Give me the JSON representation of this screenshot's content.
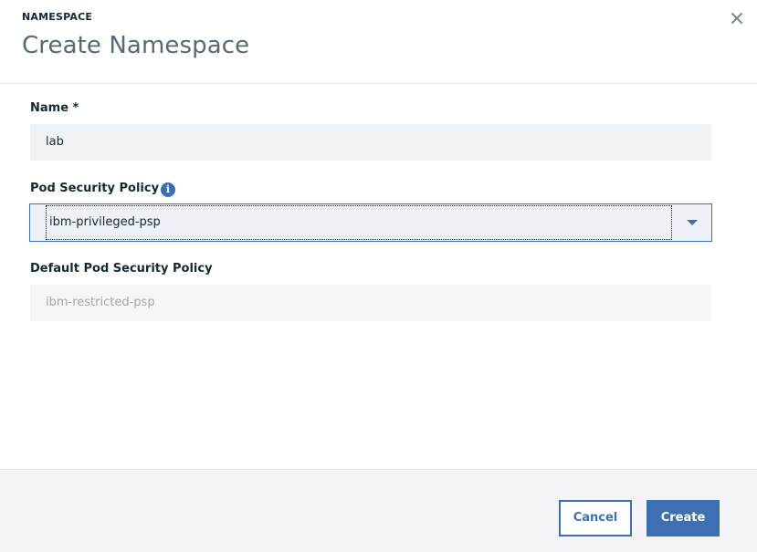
{
  "modal": {
    "eyebrow": "NAMESPACE",
    "title": "Create Namespace"
  },
  "form": {
    "name": {
      "label": "Name *",
      "value": "lab"
    },
    "pod_security_policy": {
      "label": "Pod Security Policy *",
      "selected": "ibm-privileged-psp"
    },
    "default_pod_security_policy": {
      "label": "Default Pod Security Policy",
      "value": "ibm-restricted-psp"
    }
  },
  "footer": {
    "cancel_label": "Cancel",
    "create_label": "Create"
  },
  "colors": {
    "accent": "#3d70b2",
    "title": "#5a6872",
    "input_bg": "#f0f3f6",
    "footer_bg": "#f2f4f8"
  },
  "icons": {
    "close": "close-icon",
    "info": "info-icon",
    "caret": "chevron-down-icon"
  }
}
